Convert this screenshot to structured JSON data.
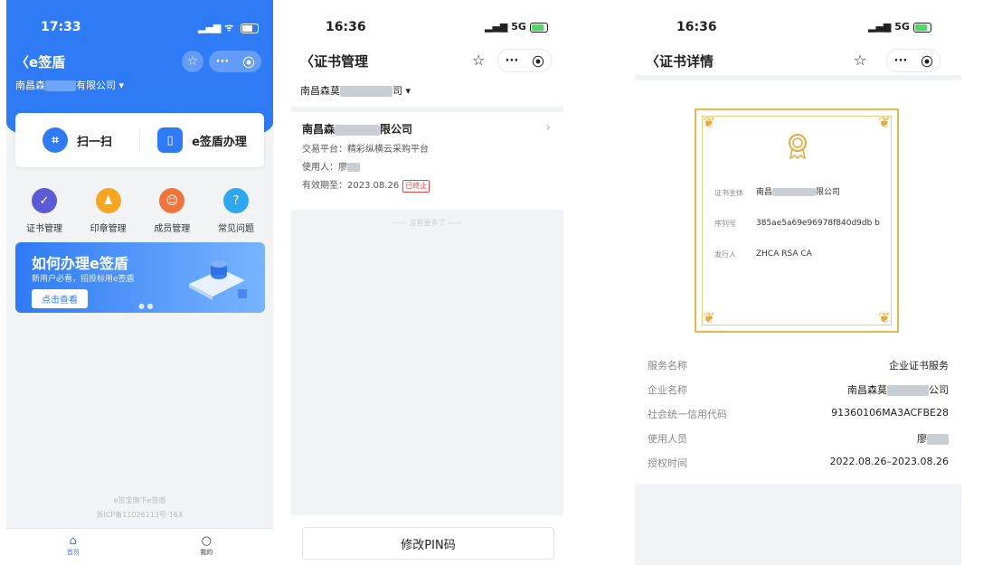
{
  "screen1": {
    "time": "17:33",
    "title": "e签盾",
    "company_a": "南昌森",
    "company_b": "有限公司",
    "actions": [
      {
        "label": "扫一扫",
        "icon": "scan-icon"
      },
      {
        "label": "e签盾办理",
        "icon": "phone-icon"
      }
    ],
    "menu": [
      {
        "label": "证书管理",
        "color": "#5b5bd6",
        "icon": "shield-icon"
      },
      {
        "label": "印章管理",
        "color": "#f5a623",
        "icon": "seal-icon"
      },
      {
        "label": "成员管理",
        "color": "#f0743e",
        "icon": "member-icon"
      },
      {
        "label": "常见问题",
        "color": "#2fa6f0",
        "icon": "question-icon"
      }
    ],
    "banner": {
      "title": "如何办理e签盾",
      "subtitle": "新用户必看，招投标用e签盾",
      "button": "点击查看"
    },
    "footer_line1": "e签宝旗下e签盾",
    "footer_line2": "浙ICP备11026113号-16X",
    "tabs": [
      {
        "label": "首页",
        "icon": "home-icon",
        "active": true
      },
      {
        "label": "我的",
        "icon": "profile-icon",
        "active": false
      }
    ]
  },
  "screen2": {
    "time": "16:36",
    "network": "5G",
    "title": "证书管理",
    "company_a": "南昌森莫",
    "company_b": "司",
    "item": {
      "name_a": "南昌森",
      "name_b": "限公司",
      "platform": "交易平台：精彩纵横云采购平台",
      "user": "使用人：廖",
      "validity": "有效期至：2023.08.26",
      "status": "已终止"
    },
    "no_more": "没有更多了",
    "button": "修改PIN码"
  },
  "screen3": {
    "time": "16:36",
    "network": "5G",
    "title": "证书详情",
    "cert": {
      "subject_label": "证书主体",
      "subject_a": "南昌",
      "subject_b": "限公司",
      "serial_label": "序列号",
      "serial": "385ae5a69e96978f840d9db b",
      "issuer_label": "发行人",
      "issuer": "ZHCA RSA CA"
    },
    "info": [
      {
        "key": "服务名称",
        "value": "企业证书服务"
      },
      {
        "key": "企业名称",
        "value": "南昌森莫",
        "value_b": "公司"
      },
      {
        "key": "社会统一信用代码",
        "value": "91360106MA3ACFBE28"
      },
      {
        "key": "使用人员",
        "value": "廖"
      },
      {
        "key": "授权时间",
        "value": "2022.08.26–2023.08.26"
      }
    ]
  }
}
